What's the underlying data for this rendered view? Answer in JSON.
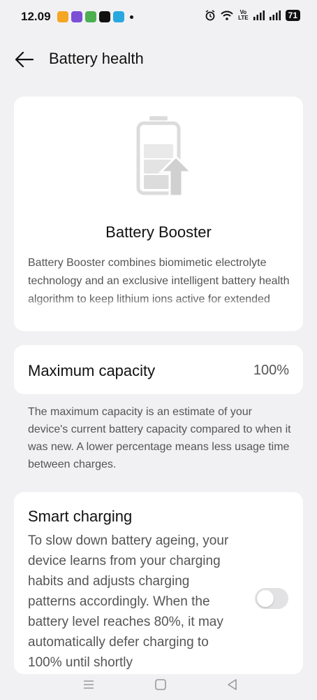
{
  "status_bar": {
    "time": "12.09",
    "volte_line1": "Vo",
    "volte_line2": "LTE",
    "battery_level": "71"
  },
  "header": {
    "title": "Battery health",
    "back_icon": "arrow-left-icon"
  },
  "booster": {
    "title": "Battery Booster",
    "description": "Battery Booster combines biomimetic electrolyte technology and an exclusive intelligent battery health algorithm to keep lithium ions active for extended battery life."
  },
  "capacity": {
    "label": "Maximum capacity",
    "value": "100%",
    "note": "The maximum capacity is an estimate of your device's current battery capacity compared to when it was new. A lower percentage means less usage time between charges."
  },
  "smart_charging": {
    "title": "Smart charging",
    "description": "To slow down battery ageing, your device learns from your charging habits and adjusts charging patterns accordingly. When the battery level reaches 80%, it may automatically defer charging to 100% until shortly",
    "enabled": false
  },
  "colors": {
    "background": "#f1f1f3",
    "card": "#ffffff",
    "toggle_off": "#e2e2e5"
  }
}
